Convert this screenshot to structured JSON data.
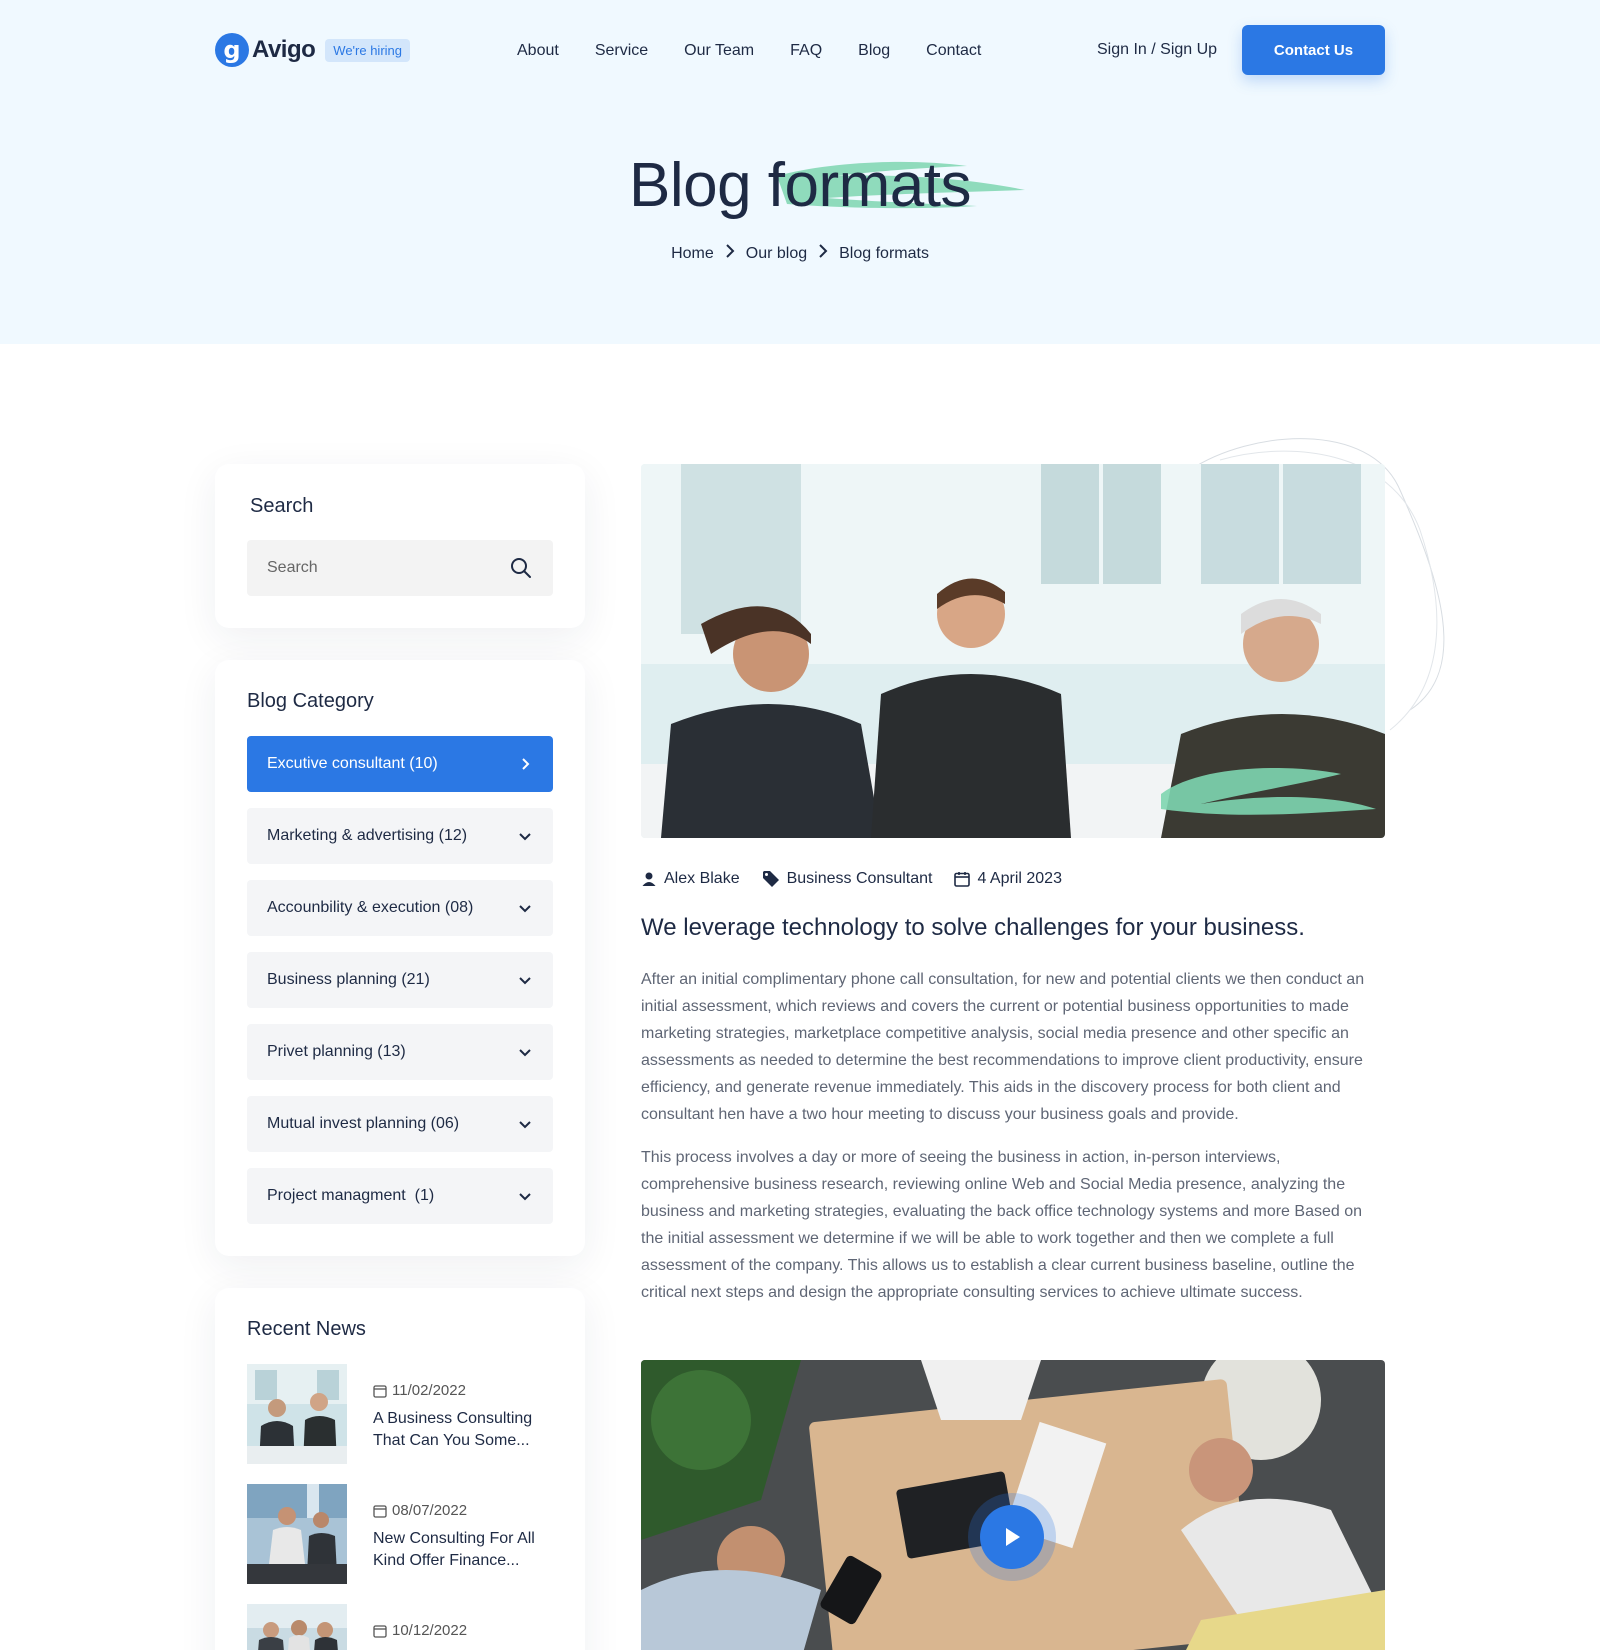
{
  "header": {
    "logo_text": "Avigo",
    "logo_letter": "g",
    "hiring_badge": "We're hiring",
    "nav": [
      "About",
      "Service",
      "Our Team",
      "FAQ",
      "Blog",
      "Contact"
    ],
    "signin": "Sign In / Sign Up",
    "contact_button": "Contact Us"
  },
  "hero": {
    "title_part1": "Blog ",
    "title_part2": "formats",
    "breadcrumb": [
      "Home",
      "Our blog",
      "Blog formats"
    ],
    "brush_color": "#7ed6b0"
  },
  "sidebar": {
    "search": {
      "heading": "Search",
      "placeholder": "Search"
    },
    "categories": {
      "heading": "Blog Category",
      "items": [
        "Excutive consultant (10)",
        "Marketing & advertising (12)",
        "Accounbility & execution (08)",
        "Business planning (21)",
        "Privet planning (13)",
        "Mutual invest planning (06)",
        "Project managment  (1)"
      ]
    },
    "recent_news": {
      "heading": "Recent News",
      "items": [
        {
          "date": "11/02/2022",
          "title": "A Business Consulting That Can You Some..."
        },
        {
          "date": "08/07/2022",
          "title": "New Consulting For All Kind Offer Finance..."
        },
        {
          "date": "10/12/2022",
          "title": ""
        }
      ]
    }
  },
  "post": {
    "author": "Alex Blake",
    "category": "Business Consultant",
    "date": "4 April 2023",
    "title": "We leverage technology to solve challenges for your business.",
    "paragraph1": "After an initial complimentary phone call consultation, for new and potential clients we then conduct an initial assessment, which reviews and covers the current or potential business opportunities to made marketing strategies, marketplace competitive analysis, social media presence and other specific an assessments as needed to determine the best recommendations to improve client productivity, ensure efficiency, and generate revenue immediately. This aids in the discovery process for both client and consultant hen have a two hour meeting to discuss your business goals and provide.",
    "paragraph2": "This process involves a day or more of seeing the business in action, in-person interviews, comprehensive business research, reviewing online Web and Social Media presence, analyzing the business and marketing strategies, evaluating the back office technology systems and more Based on the initial assessment we determine if we will be able to work together and then we complete a full assessment of the company. This allows us to establish a clear current business baseline, outline the critical next steps and design the appropriate consulting services to achieve ultimate success."
  },
  "colors": {
    "accent": "#2b78e4",
    "hero_bg": "#f0f9ff",
    "text_dark": "#1e2a44",
    "brush_green": "#7ed6b0"
  },
  "icons": [
    "search-icon",
    "chevron-right-icon",
    "chevron-down-icon",
    "user-icon",
    "tag-icon",
    "calendar-icon",
    "play-icon"
  ]
}
